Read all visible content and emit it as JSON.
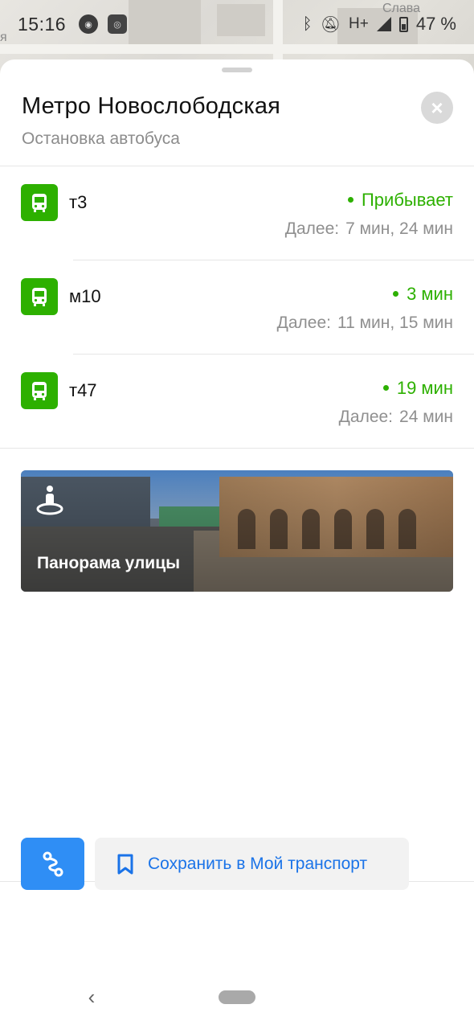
{
  "status_bar": {
    "time": "15:16",
    "network": "H+",
    "battery": "47 %",
    "icons": [
      "app-icon",
      "nfc-icon",
      "bluetooth-icon",
      "mute-icon",
      "signal-icon",
      "battery-icon"
    ]
  },
  "map": {
    "label_partial": "я",
    "label_street": "Слава"
  },
  "stop": {
    "title": "Метро Новослободская",
    "subtitle": "Остановка автобуса"
  },
  "routes": [
    {
      "number": "т3",
      "arrival": "Прибывает",
      "next_label": "Далее:",
      "next_times": "7 мин, 24 мин"
    },
    {
      "number": "м10",
      "arrival": "3 мин",
      "next_label": "Далее:",
      "next_times": "11 мин, 15 мин"
    },
    {
      "number": "т47",
      "arrival": "19 мин",
      "next_label": "Далее:",
      "next_times": "24 мин"
    }
  ],
  "panorama": {
    "label": "Панорама улицы"
  },
  "actions": {
    "save_label": "Сохранить в Мой транспорт"
  },
  "colors": {
    "accent_green": "#2db000",
    "accent_blue": "#2f8ef5",
    "link_blue": "#1a73e8"
  }
}
